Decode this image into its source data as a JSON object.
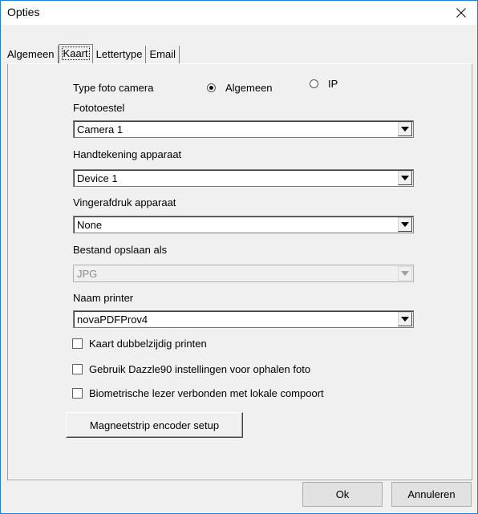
{
  "window": {
    "title": "Opties"
  },
  "tabs": [
    {
      "label": "Algemeen"
    },
    {
      "label": "Kaart"
    },
    {
      "label": "Lettertype"
    },
    {
      "label": "Email"
    }
  ],
  "camera_type": {
    "label": "Type foto camera",
    "options": [
      "Algemeen",
      "IP"
    ],
    "selected": "Algemeen"
  },
  "fototoestel": {
    "label": "Fototoestel",
    "value": "Camera 1"
  },
  "handtekening": {
    "label": "Handtekening apparaat",
    "value": "Device 1"
  },
  "vingerafdruk": {
    "label": "Vingerafdruk apparaat",
    "value": "None"
  },
  "bestand": {
    "label": "Bestand opslaan als",
    "value": "JPG"
  },
  "printer": {
    "label": "Naam printer",
    "value": "novaPDFProv4"
  },
  "checkboxes": [
    {
      "label": "Kaart dubbelzijdig printen",
      "checked": false
    },
    {
      "label": "Gebruik Dazzle90 instellingen voor ophalen foto",
      "checked": false
    },
    {
      "label": "Biometrische lezer verbonden met lokale compoort",
      "checked": false
    }
  ],
  "encoder_button": "Magneetstrip encoder setup",
  "buttons": {
    "ok": "Ok",
    "cancel": "Annuleren"
  }
}
